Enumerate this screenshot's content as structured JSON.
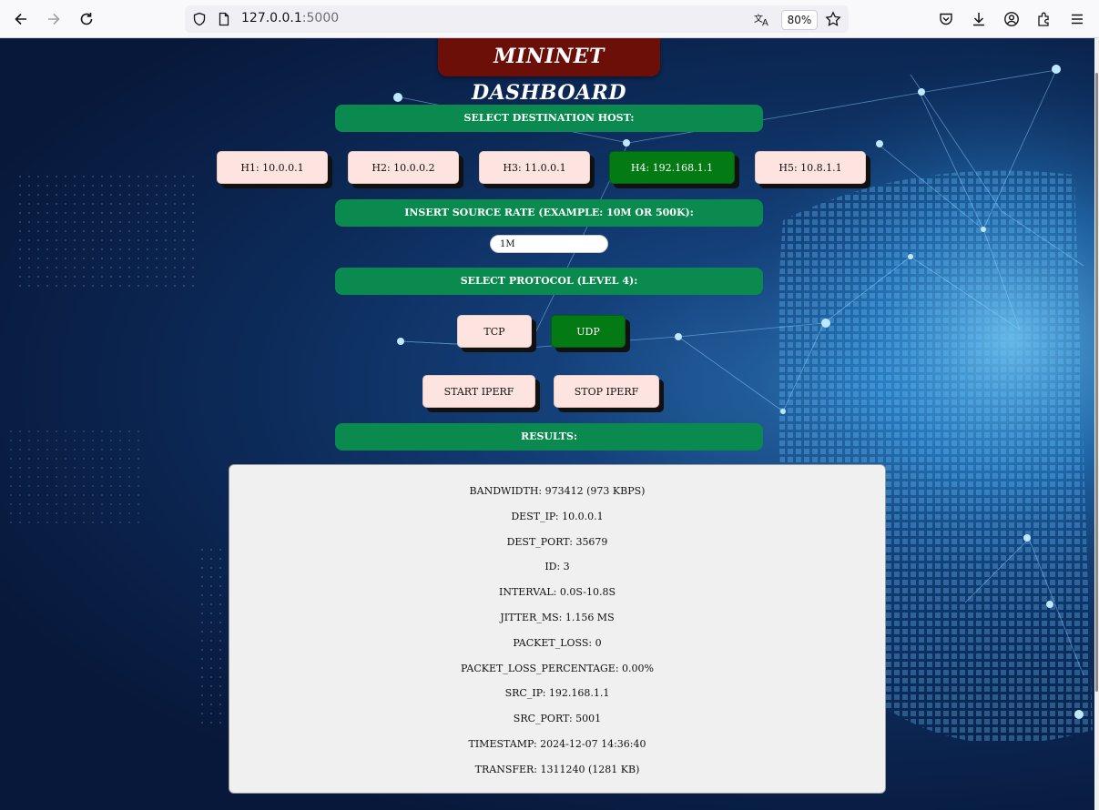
{
  "browser": {
    "url_host": "127.0.0.1",
    "url_port": ":5000",
    "zoom": "80%",
    "icons": [
      "back-icon",
      "forward-icon",
      "reload-icon",
      "shield-icon",
      "page-icon",
      "translate-icon",
      "bookmark-star-icon",
      "pocket-icon",
      "download-icon",
      "account-icon",
      "extensions-icon",
      "menu-icon"
    ]
  },
  "dashboard": {
    "title": "MININET DASHBOARD",
    "select_host_label": "SELECT DESTINATION HOST:",
    "hosts": [
      {
        "label": "H1: 10.0.0.1",
        "selected": false
      },
      {
        "label": "H2: 10.0.0.2",
        "selected": false
      },
      {
        "label": "H3: 11.0.0.1",
        "selected": false
      },
      {
        "label": "H4: 192.168.1.1",
        "selected": true
      },
      {
        "label": "H5: 10.8.1.1",
        "selected": false
      }
    ],
    "rate_label": "INSERT SOURCE RATE (EXAMPLE: 10M OR 500K):",
    "rate_value": "1M",
    "protocol_label": "SELECT PROTOCOL (LEVEL 4):",
    "protocols": [
      {
        "label": "TCP",
        "selected": false
      },
      {
        "label": "UDP",
        "selected": true
      }
    ],
    "start_label": "START IPERF",
    "stop_label": "STOP IPERF",
    "results_label": "RESULTS:",
    "results": [
      "BANDWIDTH: 973412 (973 KBPS)",
      "DEST_IP: 10.0.0.1",
      "DEST_PORT: 35679",
      "ID: 3",
      "INTERVAL: 0.0S-10.8S",
      "JITTER_MS: 1.156 MS",
      "PACKET_LOSS: 0",
      "PACKET_LOSS_PERCENTAGE: 0.00%",
      "SRC_IP: 192.168.1.1",
      "SRC_PORT: 5001",
      "TIMESTAMP: 2024-12-07 14:36:40",
      "TRANSFER: 1311240 (1281 KB)"
    ]
  },
  "colors": {
    "header_bar": "#0a8a4e",
    "selected": "#047a14",
    "unselected": "#fde4e0",
    "title_bg": "#6b0f08"
  }
}
